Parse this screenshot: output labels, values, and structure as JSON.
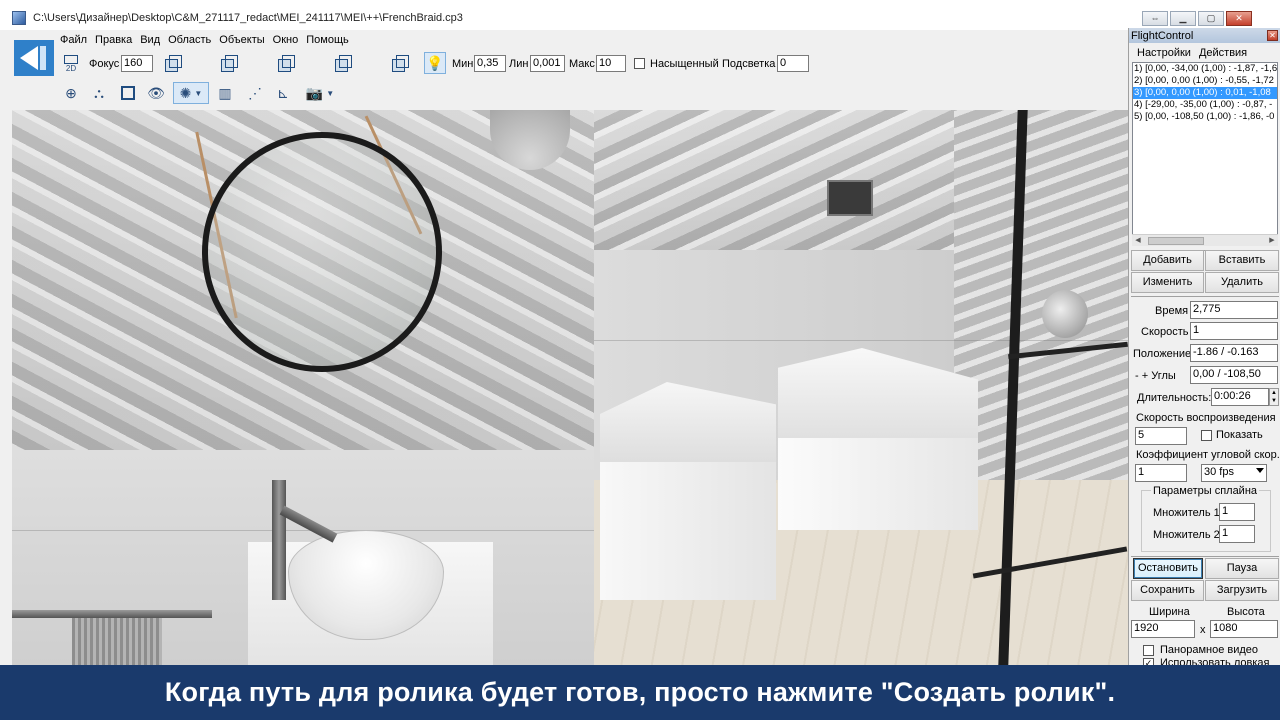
{
  "window": {
    "title": "C:\\Users\\Дизайнер\\Desktop\\C&M_271117_redact\\MEI_241117\\MEI\\++\\FrenchBraid.cp3"
  },
  "menu": [
    "Файл",
    "Правка",
    "Вид",
    "Область",
    "Объекты",
    "Окно",
    "Помощь"
  ],
  "toolbar": {
    "view_2d_label": "2D",
    "focus_label": "Фокус",
    "focus_value": "160",
    "min_label": "Мин",
    "min_value": "0,35",
    "lin_label": "Лин",
    "lin_value": "0,001",
    "max_label": "Макс",
    "max_value": "10",
    "saturated_label": "Насыщенный",
    "highlight_label": "Подсветка",
    "highlight_value": "0"
  },
  "flight_control": {
    "title": "FlightControl",
    "menu": [
      "Настройки",
      "Действия"
    ],
    "keyframes": [
      "1) [0,00, -34,00 (1,00) : -1,87, -1,6",
      "2) [0,00, 0,00 (1,00) : -0,55, -1,72",
      "3) [0,00, 0,00 (1,00) : 0,01, -1,08",
      "4) [-29,00, -35,00 (1,00) : -0,87, -",
      "5) [0,00, -108,50 (1,00) : -1,86, -0"
    ],
    "selected_index": 2,
    "buttons": {
      "add": "Добавить",
      "insert": "Вставить",
      "edit": "Изменить",
      "delete": "Удалить",
      "stop": "Остановить",
      "pause": "Пауза",
      "save": "Сохранить",
      "load": "Загрузить"
    },
    "fields": {
      "time_label": "Время",
      "time_value": "2,775",
      "speed_label": "Скорость",
      "speed_value": "1",
      "position_label": "Положение",
      "position_value": "-1.86 / -0.163",
      "angles_label": "-   +  Углы",
      "angles_value": "0,00 / -108,50",
      "duration_label": "Длительность:",
      "duration_value": "0:00:26",
      "playback_speed_label": "Скорость воспроизведения",
      "playback_speed_value": "5",
      "show_label": "Показать",
      "angular_coef_label": "Коэффициент угловой скор.",
      "angular_coef_value": "1",
      "fps_value": "30 fps",
      "spline_group_label": "Параметры сплайна",
      "mult1_label": "Множитель 1",
      "mult1_value": "1",
      "mult2_label": "Множитель 2",
      "mult2_value": "1",
      "width_label": "Ширина",
      "height_label": "Высота",
      "width_value": "1920",
      "x_label": "x",
      "height_value": "1080",
      "panoramic_label": "Панорамное видео",
      "extra_option_label": "Использовать ловкая"
    }
  },
  "caption": {
    "text": "Когда путь для ролика будет готов, просто нажмите \"Создать ролик\"."
  },
  "colors": {
    "caption_bg": "#1a3a6c",
    "selection": "#3399ff",
    "logo_blue": "#2f80c9"
  }
}
